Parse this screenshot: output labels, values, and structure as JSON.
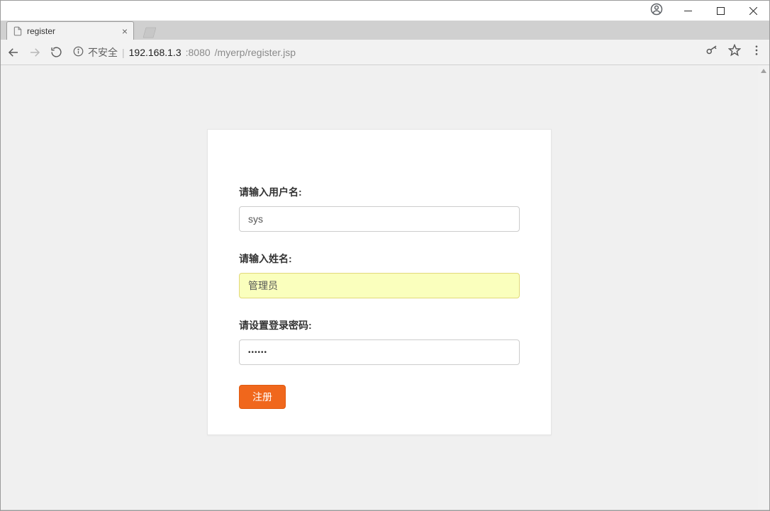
{
  "window": {
    "tab_title": "register"
  },
  "addressbar": {
    "insecure_label": "不安全",
    "host": "192.168.1.3",
    "port": ":8080",
    "path": "/myerp/register.jsp"
  },
  "form": {
    "username_label": "请输入用户名:",
    "username_value": "sys",
    "name_label": "请输入姓名:",
    "name_value": "管理员",
    "password_label": "请设置登录密码:",
    "password_mask": "••••••",
    "submit_label": "注册"
  }
}
